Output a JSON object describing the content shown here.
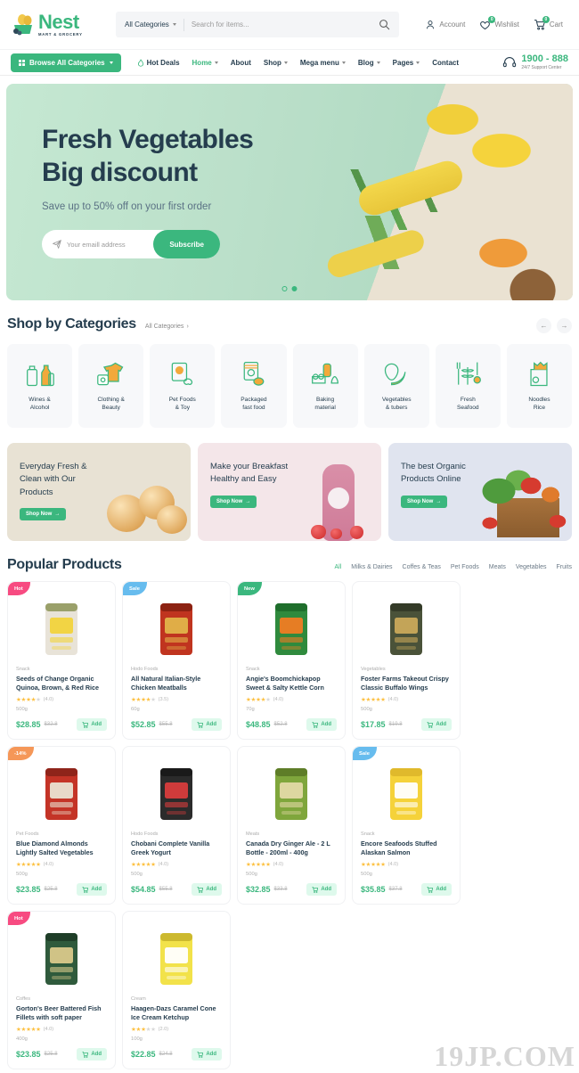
{
  "header": {
    "logo_name": "Nest",
    "logo_sub": "MART & GROCERY",
    "category_select": "All Categories",
    "search_placeholder": "Search for items...",
    "account_label": "Account",
    "wishlist_label": "Wishlist",
    "wishlist_count": "0",
    "cart_label": "Cart",
    "cart_count": "0"
  },
  "nav": {
    "browse_label": "Browse All Categories",
    "items": [
      {
        "label": "Hot Deals",
        "caret": false,
        "active": false
      },
      {
        "label": "Home",
        "caret": true,
        "active": true
      },
      {
        "label": "About",
        "caret": false,
        "active": false
      },
      {
        "label": "Shop",
        "caret": true,
        "active": false
      },
      {
        "label": "Mega menu",
        "caret": true,
        "active": false
      },
      {
        "label": "Blog",
        "caret": true,
        "active": false
      },
      {
        "label": "Pages",
        "caret": true,
        "active": false
      },
      {
        "label": "Contact",
        "caret": false,
        "active": false
      }
    ],
    "support_number": "1900 - 888",
    "support_sub": "24/7 Support Center"
  },
  "hero": {
    "title_line1": "Fresh Vegetables",
    "title_line2": "Big discount",
    "subtitle": "Save up to 50% off on your first order",
    "email_placeholder": "Your emaill address",
    "subscribe_label": "Subscribe"
  },
  "categories_section": {
    "title": "Shop by Categories",
    "link": "All Categories",
    "prev": "←",
    "next": "→",
    "items": [
      {
        "label": "Wines &\nAlcohol",
        "icon": "bottles-icon"
      },
      {
        "label": "Clothing &\nBeauty",
        "icon": "clothing-icon"
      },
      {
        "label": "Pet Foods\n& Toy",
        "icon": "petfood-icon"
      },
      {
        "label": "Packaged\nfast food",
        "icon": "packaged-icon"
      },
      {
        "label": "Baking\nmaterial",
        "icon": "baking-icon"
      },
      {
        "label": "Vegetables\n& tubers",
        "icon": "vegetables-icon"
      },
      {
        "label": "Fresh\nSeafood",
        "icon": "seafood-icon"
      },
      {
        "label": "Noodles\nRice",
        "icon": "noodles-icon"
      }
    ]
  },
  "promos": [
    {
      "title": "Everyday Fresh &\nClean with Our\nProducts",
      "cta": "Shop Now",
      "color": "#e8e2d4"
    },
    {
      "title": "Make your Breakfast\nHealthy and Easy",
      "cta": "Shop Now",
      "color": "#f4e6e9"
    },
    {
      "title": "The best Organic\nProducts Online",
      "cta": "Shop Now",
      "color": "#e0e4ef"
    }
  ],
  "popular": {
    "title": "Popular Products",
    "tabs": [
      "All",
      "Milks & Dairies",
      "Coffes & Teas",
      "Pet Foods",
      "Meats",
      "Vegetables",
      "Fruits"
    ],
    "active_tab": "All",
    "add_label": "Add",
    "products": [
      {
        "tag": "Hot",
        "tag_type": "t-hot",
        "category": "Snack",
        "name": "Seeds of Change Organic Quinoa, Brown, & Red Rice",
        "stars": 4,
        "rating": "(4.0)",
        "weight": "500g",
        "price": "$28.85",
        "old": "$32.8"
      },
      {
        "tag": "Sale",
        "tag_type": "t-sale",
        "category": "Hodo Foods",
        "name": "All Natural Italian-Style Chicken Meatballs",
        "stars": 4,
        "rating": "(3.5)",
        "weight": "60g",
        "price": "$52.85",
        "old": "$55.8"
      },
      {
        "tag": "New",
        "tag_type": "t-new",
        "category": "Snack",
        "name": "Angie's Boomchickapop Sweet & Salty Kettle Corn",
        "stars": 4,
        "rating": "(4.0)",
        "weight": "70g",
        "price": "$48.85",
        "old": "$52.8"
      },
      {
        "tag": "",
        "tag_type": "",
        "category": "Vegetables",
        "name": "Foster Farms Takeout Crispy Classic Buffalo Wings",
        "stars": 5,
        "rating": "(4.0)",
        "weight": "500g",
        "price": "$17.85",
        "old": "$19.8"
      },
      {
        "tag": "-14%",
        "tag_type": "t-off",
        "category": "Pet Foods",
        "name": "Blue Diamond Almonds Lightly Salted Vegetables",
        "stars": 5,
        "rating": "(4.0)",
        "weight": "500g",
        "price": "$23.85",
        "old": "$25.8"
      },
      {
        "tag": "",
        "tag_type": "",
        "category": "Hodo Foods",
        "name": "Chobani Complete Vanilla Greek Yogurt",
        "stars": 5,
        "rating": "(4.0)",
        "weight": "500g",
        "price": "$54.85",
        "old": "$55.8"
      },
      {
        "tag": "",
        "tag_type": "",
        "category": "Meats",
        "name": "Canada Dry Ginger Ale - 2 L Bottle - 200ml - 400g",
        "stars": 5,
        "rating": "(4.0)",
        "weight": "500g",
        "price": "$32.85",
        "old": "$33.8"
      },
      {
        "tag": "Sale",
        "tag_type": "t-sale",
        "category": "Snack",
        "name": "Encore Seafoods Stuffed Alaskan Salmon",
        "stars": 5,
        "rating": "(4.0)",
        "weight": "500g",
        "price": "$35.85",
        "old": "$37.8"
      },
      {
        "tag": "Hot",
        "tag_type": "t-hot",
        "category": "Coffes",
        "name": "Gorton's Beer Battered Fish Fillets with soft paper",
        "stars": 5,
        "rating": "(4.0)",
        "weight": "400g",
        "price": "$23.85",
        "old": "$25.8"
      },
      {
        "tag": "",
        "tag_type": "",
        "category": "Cream",
        "name": "Haagen-Dazs Caramel Cone Ice Cream Ketchup",
        "stars": 3,
        "rating": "(2.0)",
        "weight": "100g",
        "price": "$22.85",
        "old": "$24.8"
      }
    ]
  },
  "watermark": "19JP.COM",
  "colors": {
    "brand": "#3BB77E",
    "dark": "#253d4e",
    "star": "#FDC040"
  }
}
